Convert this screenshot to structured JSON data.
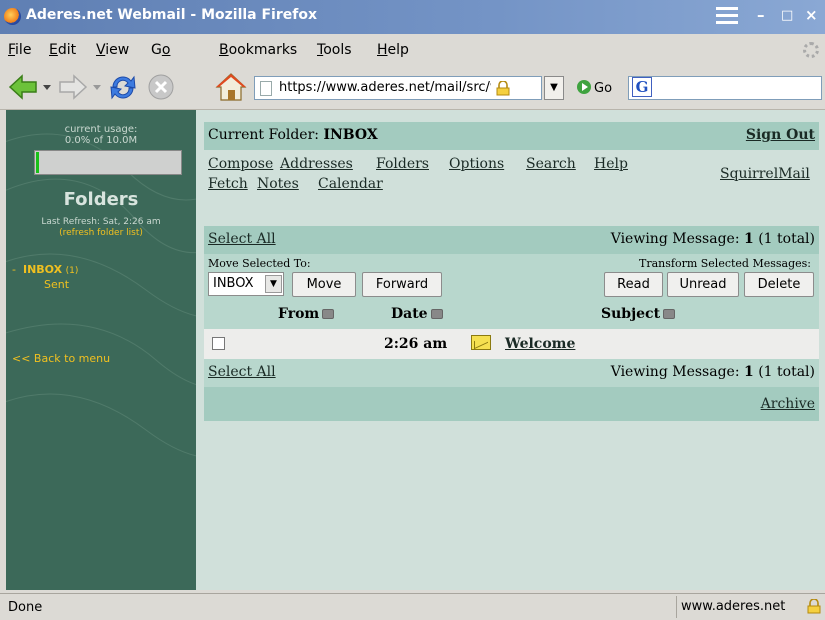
{
  "window": {
    "title": "Aderes.net Webmail - Mozilla Firefox",
    "minimize_glyph": "–",
    "maximize_glyph": "□",
    "close_glyph": "×"
  },
  "menu": {
    "file": {
      "accel": "F",
      "rest": "ile"
    },
    "edit": {
      "accel": "E",
      "rest": "dit"
    },
    "view": {
      "accel": "V",
      "rest": "iew"
    },
    "go": {
      "pre": "G",
      "accel": "o",
      "rest": ""
    },
    "bookmarks": {
      "accel": "B",
      "rest": "ookmarks"
    },
    "tools": {
      "accel": "T",
      "rest": "ools"
    },
    "help": {
      "accel": "H",
      "rest": "elp"
    }
  },
  "toolbar": {
    "url": "https://www.aderes.net/mail/src/webmail.php",
    "url_dropdown_glyph": "▼",
    "go_label": "Go",
    "search_engine_glyph": "G"
  },
  "sidebar": {
    "usage_label": "current usage:",
    "usage_value": "0.0% of 10.0M",
    "quota_fraction": 0.0,
    "folders_title": "Folders",
    "last_refresh": "Last Refresh: Sat, 2:26 am",
    "refresh_link": "(refresh folder list)",
    "folders": [
      {
        "prefix": "-",
        "name": "INBOX",
        "count": "(1)"
      },
      {
        "prefix": "",
        "name": "Sent",
        "count": ""
      }
    ],
    "back_link": "<< Back to menu"
  },
  "main": {
    "current_folder_label": "Current Folder: ",
    "current_folder": "INBOX",
    "sign_out": "Sign Out",
    "nav": {
      "compose": "Compose",
      "addresses": "Addresses",
      "folders": "Folders",
      "options": "Options",
      "search": "Search",
      "help": "Help",
      "fetch": "Fetch",
      "notes": "Notes",
      "calendar": "Calendar",
      "squirrelmail": "SquirrelMail"
    },
    "select_all": "Select All",
    "viewing_prefix": "Viewing Message: ",
    "viewing_num": "1",
    "viewing_total": " (1 total)",
    "move_selected_to": "Move Selected To:",
    "move_folder_value": "INBOX",
    "move_folder_arrow": "▼",
    "move_button": "Move",
    "forward_button": "Forward",
    "transform_label": "Transform Selected Messages:",
    "read_button": "Read",
    "unread_button": "Unread",
    "delete_button": "Delete",
    "columns": {
      "from": "From",
      "date": "Date",
      "subject": "Subject"
    },
    "messages": [
      {
        "from": "",
        "date": "2:26 am",
        "subject": "Welcome"
      }
    ],
    "archive": "Archive"
  },
  "status": {
    "text": "Done",
    "domain": "www.aderes.net"
  },
  "colors": {
    "sidebar_bg": "#3c6959",
    "content_bg": "#d0e0da",
    "header_bar": "#a3cbbf",
    "row_bar": "#b8d7cd",
    "link_yellow": "#f0c020"
  }
}
